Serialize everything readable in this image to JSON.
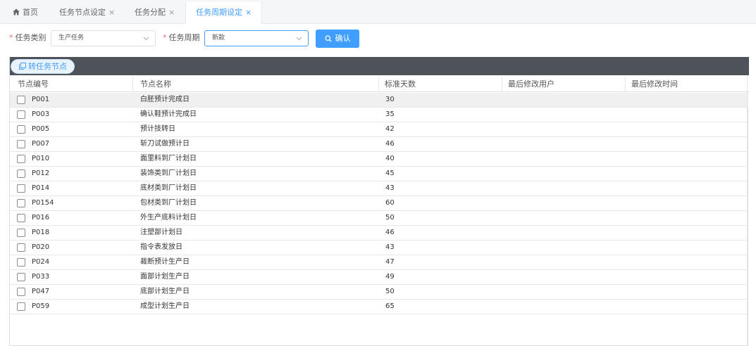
{
  "tabs": [
    {
      "label": "首页",
      "closable": false,
      "active": false,
      "icon": "home-icon"
    },
    {
      "label": "任务节点设定",
      "closable": true,
      "active": false
    },
    {
      "label": "任务分配",
      "closable": true,
      "active": false
    },
    {
      "label": "任务周期设定",
      "closable": true,
      "active": true
    }
  ],
  "close_glyph": "×",
  "required_mark": "*",
  "filters": {
    "category_label": "任务类别",
    "category_value": "生产任务",
    "cycle_label": "任务周期",
    "cycle_value": "新款",
    "confirm_label": "确认"
  },
  "toolbar": {
    "convert_label": "转任务节点"
  },
  "table": {
    "headers": [
      "节点编号",
      "节点名称",
      "标准天数",
      "最后修改用户",
      "最后修改时间"
    ],
    "rows": [
      {
        "code": "P001",
        "name": "白胚预计完成日",
        "days": "30",
        "user": "",
        "time": "",
        "selected": true
      },
      {
        "code": "P003",
        "name": "确认鞋预计完成日",
        "days": "35",
        "user": "",
        "time": ""
      },
      {
        "code": "P005",
        "name": "预计技转日",
        "days": "42",
        "user": "",
        "time": ""
      },
      {
        "code": "P007",
        "name": "斩刀试做预计日",
        "days": "46",
        "user": "",
        "time": ""
      },
      {
        "code": "P010",
        "name": "面里料到厂计划日",
        "days": "40",
        "user": "",
        "time": ""
      },
      {
        "code": "P012",
        "name": "装饰类到厂计划日",
        "days": "45",
        "user": "",
        "time": ""
      },
      {
        "code": "P014",
        "name": "底材类到厂计划日",
        "days": "43",
        "user": "",
        "time": ""
      },
      {
        "code": "P0154",
        "name": "包材类到厂计划日",
        "days": "60",
        "user": "",
        "time": ""
      },
      {
        "code": "P016",
        "name": "外生产底料计划日",
        "days": "50",
        "user": "",
        "time": ""
      },
      {
        "code": "P018",
        "name": "注塑部计划日",
        "days": "46",
        "user": "",
        "time": ""
      },
      {
        "code": "P020",
        "name": "指令表发放日",
        "days": "43",
        "user": "",
        "time": ""
      },
      {
        "code": "P024",
        "name": "裁断预计生产日",
        "days": "47",
        "user": "",
        "time": ""
      },
      {
        "code": "P033",
        "name": "面部计划生产日",
        "days": "49",
        "user": "",
        "time": ""
      },
      {
        "code": "P047",
        "name": "底部计划生产日",
        "days": "50",
        "user": "",
        "time": ""
      },
      {
        "code": "P059",
        "name": "成型计划生产日",
        "days": "65",
        "user": "",
        "time": ""
      }
    ]
  },
  "colors": {
    "accent": "#409eff",
    "toolbar_bg": "#4d5358",
    "required": "#f56c6c"
  }
}
